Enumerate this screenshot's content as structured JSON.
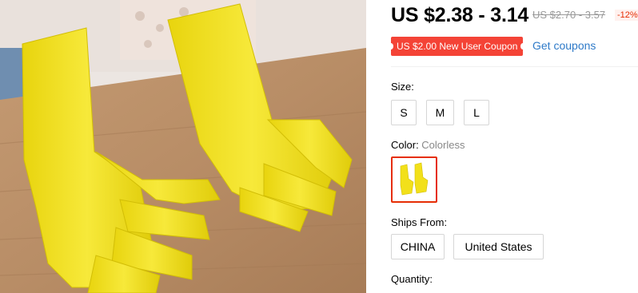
{
  "product": {
    "image_alt": "Yellow rubber gloves on wooden table"
  },
  "price": {
    "current": "US $2.38 - 3.14",
    "original": "US $2.70 - 3.57",
    "discount": "-12%"
  },
  "coupon": {
    "badge": "US $2.00 New User Coupon",
    "link": "Get coupons"
  },
  "size": {
    "label": "Size:",
    "options": [
      "S",
      "M",
      "L"
    ]
  },
  "color": {
    "label": "Color: ",
    "value": "Colorless"
  },
  "ships_from": {
    "label": "Ships From:",
    "options": [
      "CHINA",
      "United States"
    ]
  },
  "quantity": {
    "label": "Quantity:"
  },
  "colors": {
    "accent_red": "#e62e04",
    "coupon_red": "#f44336",
    "link_blue": "#2e7ac8",
    "glove_yellow": "#f2e01a"
  }
}
